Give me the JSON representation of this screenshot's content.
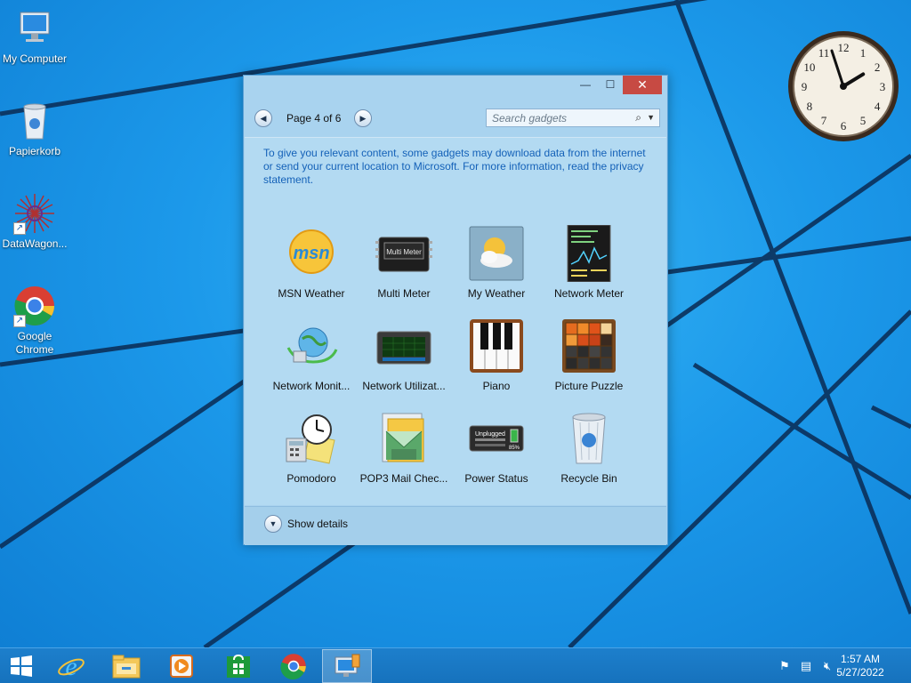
{
  "desktop": {
    "icons": [
      {
        "label": "My Computer",
        "icon": "computer-icon"
      },
      {
        "label": "Papierkorb",
        "icon": "recycle-bin-icon"
      },
      {
        "label": "DataWagon...",
        "icon": "datawagon-icon"
      },
      {
        "label": "Google Chrome",
        "icon": "chrome-icon"
      }
    ]
  },
  "clock_gadget": {
    "hour": 1,
    "minute": 57,
    "numerals": [
      "12",
      "1",
      "2",
      "3",
      "4",
      "5",
      "6",
      "7",
      "8",
      "9",
      "10",
      "11"
    ]
  },
  "window": {
    "controls": {
      "minimize": "—",
      "maximize": "☐",
      "close": "✕"
    },
    "nav": {
      "page_label": "Page 4 of 6",
      "prev": "◀",
      "next": "▶"
    },
    "search": {
      "placeholder": "Search gadgets",
      "icon": "search-icon"
    },
    "info_text": "To give you relevant content, some gadgets may download data from the internet or send your current location to Microsoft. For more information, read the privacy statement.",
    "gadgets": [
      {
        "label": "MSN Weather",
        "icon": "msn-weather-icon"
      },
      {
        "label": "Multi Meter",
        "icon": "multi-meter-icon"
      },
      {
        "label": "My Weather",
        "icon": "my-weather-icon"
      },
      {
        "label": "Network Meter",
        "icon": "network-meter-icon"
      },
      {
        "label": "Network Monit...",
        "icon": "network-monitor-icon"
      },
      {
        "label": "Network Utilizat...",
        "icon": "network-utilization-icon"
      },
      {
        "label": "Piano",
        "icon": "piano-icon"
      },
      {
        "label": "Picture Puzzle",
        "icon": "picture-puzzle-icon"
      },
      {
        "label": "Pomodoro",
        "icon": "pomodoro-icon"
      },
      {
        "label": "POP3 Mail Chec...",
        "icon": "pop3-mail-icon"
      },
      {
        "label": "Power Status",
        "icon": "power-status-icon"
      },
      {
        "label": "Recycle Bin",
        "icon": "recycle-bin-icon"
      }
    ],
    "multi_meter_text": "Multi Meter",
    "power_text": "Unplugged",
    "power_pct": "85%",
    "details_label": "Show details"
  },
  "taskbar": {
    "items": [
      "start-icon",
      "internet-explorer-icon",
      "file-explorer-icon",
      "media-player-icon",
      "store-icon",
      "chrome-icon",
      "desktop-gadgets-icon"
    ],
    "time": "1:57 AM",
    "date": "5/27/2022"
  },
  "colors": {
    "accent": "#1672bd",
    "close": "#c74a43",
    "info_text": "#1461b8"
  }
}
